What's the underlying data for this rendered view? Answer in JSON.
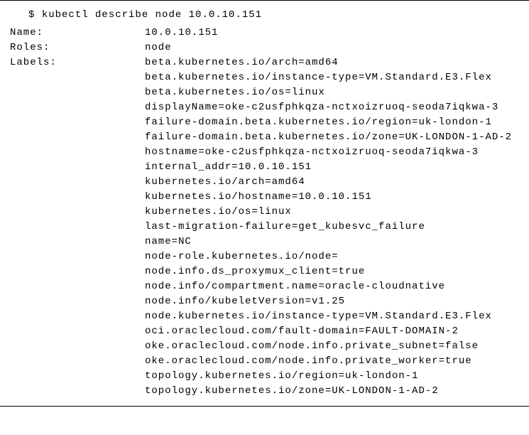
{
  "command": {
    "prompt": "$",
    "text": "kubectl describe node 10.0.10.151"
  },
  "fields": {
    "name": {
      "label": "Name:",
      "value": "10.0.10.151"
    },
    "roles": {
      "label": "Roles:",
      "value": "node"
    },
    "labels": {
      "label": "Labels:",
      "lines": [
        "beta.kubernetes.io/arch=amd64",
        "beta.kubernetes.io/instance-type=VM.Standard.E3.Flex",
        "beta.kubernetes.io/os=linux",
        "displayName=oke-c2usfphkqza-nctxoizruoq-seoda7iqkwa-3",
        "failure-domain.beta.kubernetes.io/region=uk-london-1",
        "failure-domain.beta.kubernetes.io/zone=UK-LONDON-1-AD-2",
        "hostname=oke-c2usfphkqza-nctxoizruoq-seoda7iqkwa-3",
        "internal_addr=10.0.10.151",
        "kubernetes.io/arch=amd64",
        "kubernetes.io/hostname=10.0.10.151",
        "kubernetes.io/os=linux",
        "last-migration-failure=get_kubesvc_failure",
        "name=NC",
        "node-role.kubernetes.io/node=",
        "node.info.ds_proxymux_client=true",
        "node.info/compartment.name=oracle-cloudnative",
        "node.info/kubeletVersion=v1.25",
        "node.kubernetes.io/instance-type=VM.Standard.E3.Flex",
        "oci.oraclecloud.com/fault-domain=FAULT-DOMAIN-2",
        "oke.oraclecloud.com/node.info.private_subnet=false",
        "oke.oraclecloud.com/node.info.private_worker=true",
        "topology.kubernetes.io/region=uk-london-1",
        "topology.kubernetes.io/zone=UK-LONDON-1-AD-2"
      ]
    }
  }
}
